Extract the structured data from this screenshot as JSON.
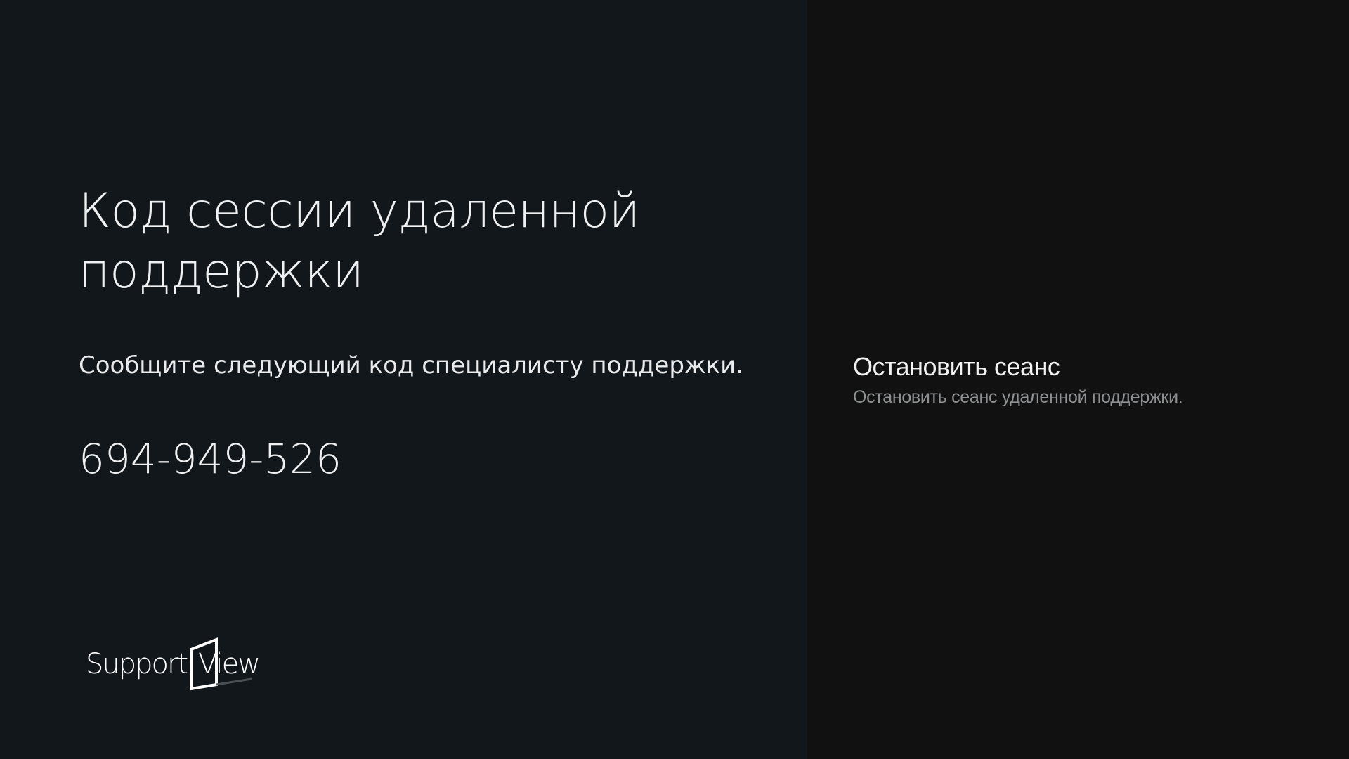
{
  "main": {
    "title": "Код сессии удаленной поддержки",
    "instruction": "Сообщите следующий код специалисту поддержки.",
    "session_code": "694-949-526"
  },
  "logo": {
    "text_left": "Support",
    "text_right": "View"
  },
  "actions": {
    "stop_title": "Остановить сеанс",
    "stop_description": "Остановить сеанс удаленной поддержки."
  },
  "colors": {
    "left_background": "#12171b",
    "right_background": "#111111",
    "primary_text": "#eef0f1",
    "secondary_text": "#8f9193"
  }
}
